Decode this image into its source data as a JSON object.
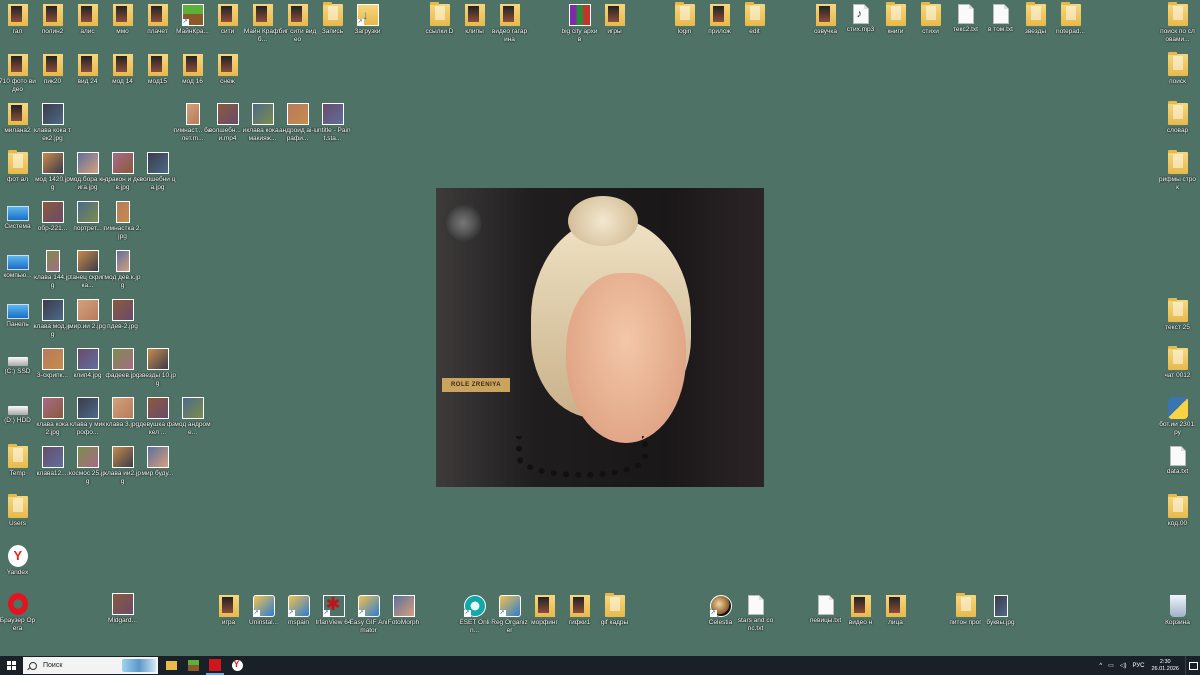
{
  "desktop": {
    "icons": [
      {
        "id": "r1c1",
        "label": "гал",
        "type": "pfolder"
      },
      {
        "id": "r1c2",
        "label": "полин2",
        "type": "pfolder"
      },
      {
        "id": "r1c3",
        "label": "алис",
        "type": "pfolder"
      },
      {
        "id": "r1c4",
        "label": "ммо",
        "type": "pfolder"
      },
      {
        "id": "r1c5",
        "label": "плачет",
        "type": "pfolder"
      },
      {
        "id": "r1c6",
        "label": "МайнКра...",
        "type": "minecraft"
      },
      {
        "id": "r1c7",
        "label": "сити",
        "type": "pfolder"
      },
      {
        "id": "r1c8",
        "label": "Майн Крафт б...",
        "type": "pfolder"
      },
      {
        "id": "r1c9",
        "label": "биг сити видео",
        "type": "pfolder"
      },
      {
        "id": "r1c10",
        "label": "Запись",
        "type": "folder"
      },
      {
        "id": "r1c11",
        "label": "Загрузки",
        "type": "download"
      },
      {
        "id": "r1c12",
        "label": "ссылки D",
        "type": "folder"
      },
      {
        "id": "r1c13",
        "label": "клипы",
        "type": "pfolder"
      },
      {
        "id": "r1c14",
        "label": "видео гагарина",
        "type": "pfolder"
      },
      {
        "id": "r1c15",
        "label": "big city архив",
        "type": "winrar"
      },
      {
        "id": "r1c16",
        "label": "игры",
        "type": "pfolder"
      },
      {
        "id": "r1c17",
        "label": "login",
        "type": "folder"
      },
      {
        "id": "r1c18",
        "label": "прилож",
        "type": "pfolder"
      },
      {
        "id": "r1c19",
        "label": "edit",
        "type": "folder"
      },
      {
        "id": "r1c20",
        "label": "озвучка",
        "type": "pfolder"
      },
      {
        "id": "r1c21",
        "label": "стих.mp3",
        "type": "audio"
      },
      {
        "id": "r1c22",
        "label": "книги",
        "type": "folder"
      },
      {
        "id": "r1c23",
        "label": "стихи",
        "type": "folder"
      },
      {
        "id": "r1c24",
        "label": "текс2.txt",
        "type": "file"
      },
      {
        "id": "r1c25",
        "label": "в том.txt",
        "type": "file"
      },
      {
        "id": "r1c26",
        "label": "звезды",
        "type": "folder"
      },
      {
        "id": "r1c27",
        "label": "notepad...",
        "type": "folder"
      },
      {
        "id": "r1c28",
        "label": "поиск по словами...",
        "type": "folder"
      },
      {
        "id": "c1r2",
        "label": "710 фото видео",
        "type": "pfolder"
      },
      {
        "id": "c2r2",
        "label": "пик20",
        "type": "pfolder"
      },
      {
        "id": "c3r2",
        "label": "вид 24",
        "type": "pfolder"
      },
      {
        "id": "c4r2",
        "label": "мод 14",
        "type": "pfolder"
      },
      {
        "id": "c5r2",
        "label": "мод15",
        "type": "pfolder"
      },
      {
        "id": "c6r2",
        "label": "мод 16",
        "type": "pfolder"
      },
      {
        "id": "c7r2",
        "label": "снеж",
        "type": "pfolder"
      },
      {
        "id": "c1r3",
        "label": "милана2",
        "type": "pfolder"
      },
      {
        "id": "c2r3",
        "label": "клава кока тек2.jpg",
        "type": "img"
      },
      {
        "id": "c5r3",
        "label": "гимнаст... балет.m...",
        "type": "imgtall"
      },
      {
        "id": "c6r3",
        "label": "волшебн... ии.mp4",
        "type": "img"
      },
      {
        "id": "c7r3",
        "label": "клава кока макияж...",
        "type": "img"
      },
      {
        "id": "c8r3",
        "label": "андроид аi-графи...",
        "type": "img"
      },
      {
        "id": "c9r3",
        "label": "untitle - Paint.sta...",
        "type": "img"
      },
      {
        "id": "c1r4",
        "label": "фот ал",
        "type": "folder"
      },
      {
        "id": "c2r4",
        "label": "мод 1420.jpg",
        "type": "img"
      },
      {
        "id": "c3r4",
        "label": "мод.бора книга.jpg",
        "type": "img"
      },
      {
        "id": "c4r4",
        "label": "дракон и дев.jpg",
        "type": "img"
      },
      {
        "id": "c5r4",
        "label": "волшебни ца.jpg",
        "type": "img"
      },
      {
        "id": "c1r5",
        "label": "Система",
        "type": "pc"
      },
      {
        "id": "c2r5",
        "label": "обр-221...",
        "type": "img"
      },
      {
        "id": "c3r5",
        "label": "портрет...",
        "type": "img"
      },
      {
        "id": "c4r5",
        "label": "гимнастка 2.jpg",
        "type": "imgtall"
      },
      {
        "id": "c1r6",
        "label": "компью...",
        "type": "pc"
      },
      {
        "id": "c2r6",
        "label": "клава 144.jpg",
        "type": "imgtall"
      },
      {
        "id": "c3r6",
        "label": "танец скрипка...",
        "type": "img"
      },
      {
        "id": "c4r6",
        "label": "мод дев.к.jpg",
        "type": "imgtall"
      },
      {
        "id": "c1r7",
        "label": "Панель",
        "type": "pc"
      },
      {
        "id": "c2r7",
        "label": "клава мод.jpg",
        "type": "img"
      },
      {
        "id": "c3r7",
        "label": "мир.ии 2.jpg",
        "type": "img"
      },
      {
        "id": "c4r7",
        "label": "пдев-2.jpg",
        "type": "img"
      },
      {
        "id": "c1r8",
        "label": "(C:) SSD",
        "type": "drive"
      },
      {
        "id": "c2r8",
        "label": "3-скрипк...",
        "type": "img"
      },
      {
        "id": "c3r8",
        "label": "клип4.jpg",
        "type": "img"
      },
      {
        "id": "c4r8",
        "label": "фадеев.jpg",
        "type": "img"
      },
      {
        "id": "c5r8",
        "label": "звезды 10.jpg",
        "type": "img"
      },
      {
        "id": "c1r9",
        "label": "(D:) HDD",
        "type": "drive"
      },
      {
        "id": "c2r9",
        "label": "клава кока 2.jpg",
        "type": "img"
      },
      {
        "id": "c3r9",
        "label": "клава у микрофо...",
        "type": "img"
      },
      {
        "id": "c4r9",
        "label": "клава 3.jpg",
        "type": "img"
      },
      {
        "id": "c5r9",
        "label": "девушка факел ...",
        "type": "img"
      },
      {
        "id": "c6r9",
        "label": "мод андроме...",
        "type": "img"
      },
      {
        "id": "c1r10",
        "label": "Temp",
        "type": "folder"
      },
      {
        "id": "c2r10",
        "label": "клава12....",
        "type": "img"
      },
      {
        "id": "c3r10",
        "label": "космос 25.jpg",
        "type": "img"
      },
      {
        "id": "c4r10",
        "label": "клава ии2.jpg",
        "type": "img"
      },
      {
        "id": "c5r10",
        "label": "мир буду...",
        "type": "img"
      },
      {
        "id": "c1r11",
        "label": "Users",
        "type": "folder"
      },
      {
        "id": "c1r12",
        "label": "Yandex",
        "type": "yandex"
      },
      {
        "id": "b1",
        "label": "Браузер Opera",
        "type": "opera"
      },
      {
        "id": "b2",
        "label": "Midgard...",
        "type": "img"
      },
      {
        "id": "b3",
        "label": "игра",
        "type": "pfolder"
      },
      {
        "id": "b4",
        "label": "Uninstal...",
        "type": "app"
      },
      {
        "id": "b5",
        "label": "mspain",
        "type": "app"
      },
      {
        "id": "b6",
        "label": "IrfanView 64",
        "type": "irfan"
      },
      {
        "id": "b7",
        "label": "Easy GIF Animator",
        "type": "app"
      },
      {
        "id": "b8",
        "label": "FotoMorph",
        "type": "img"
      },
      {
        "id": "b9",
        "label": "ESET Onlin...",
        "type": "eset"
      },
      {
        "id": "b10",
        "label": "Reg Organizer",
        "type": "app"
      },
      {
        "id": "b11",
        "label": "морфинг",
        "type": "pfolder"
      },
      {
        "id": "b12",
        "label": "гифки1",
        "type": "pfolder"
      },
      {
        "id": "b13",
        "label": "gif кадры",
        "type": "folder"
      },
      {
        "id": "b14",
        "label": "Celestia",
        "type": "celestia"
      },
      {
        "id": "b15",
        "label": "stars and conc.txt",
        "type": "file"
      },
      {
        "id": "b16",
        "label": "певицы.txt",
        "type": "file"
      },
      {
        "id": "b17",
        "label": "видео н",
        "type": "pfolder"
      },
      {
        "id": "b18",
        "label": "лица",
        "type": "pfolder"
      },
      {
        "id": "b19",
        "label": "питон прог",
        "type": "folder"
      },
      {
        "id": "b20",
        "label": "буквы.jpg",
        "type": "imgtall"
      },
      {
        "id": "b21",
        "label": "Корзина",
        "type": "recycle"
      },
      {
        "id": "rc2",
        "label": "поиск",
        "type": "folder"
      },
      {
        "id": "rc3",
        "label": "словар",
        "type": "folder"
      },
      {
        "id": "rc4",
        "label": "рифмы строк",
        "type": "folder"
      },
      {
        "id": "rc5",
        "label": "текст 25",
        "type": "folder"
      },
      {
        "id": "rc6",
        "label": "чат 0012",
        "type": "folder"
      },
      {
        "id": "rc7",
        "label": "бот.ии 2301.py",
        "type": "python"
      },
      {
        "id": "rc8",
        "label": "data.txt",
        "type": "file"
      },
      {
        "id": "rc9",
        "label": "код.00",
        "type": "folder"
      }
    ],
    "wallpaper": {
      "sign_text": "ROLE ZRENIYA"
    }
  },
  "taskbar": {
    "search_placeholder": "Поиск",
    "tray": {
      "language": "РУС",
      "time": "2:30",
      "date": "26.01.2026"
    }
  },
  "colors": {
    "desktop_bg": "#4e7266",
    "taskbar_bg": "#1a2027"
  }
}
